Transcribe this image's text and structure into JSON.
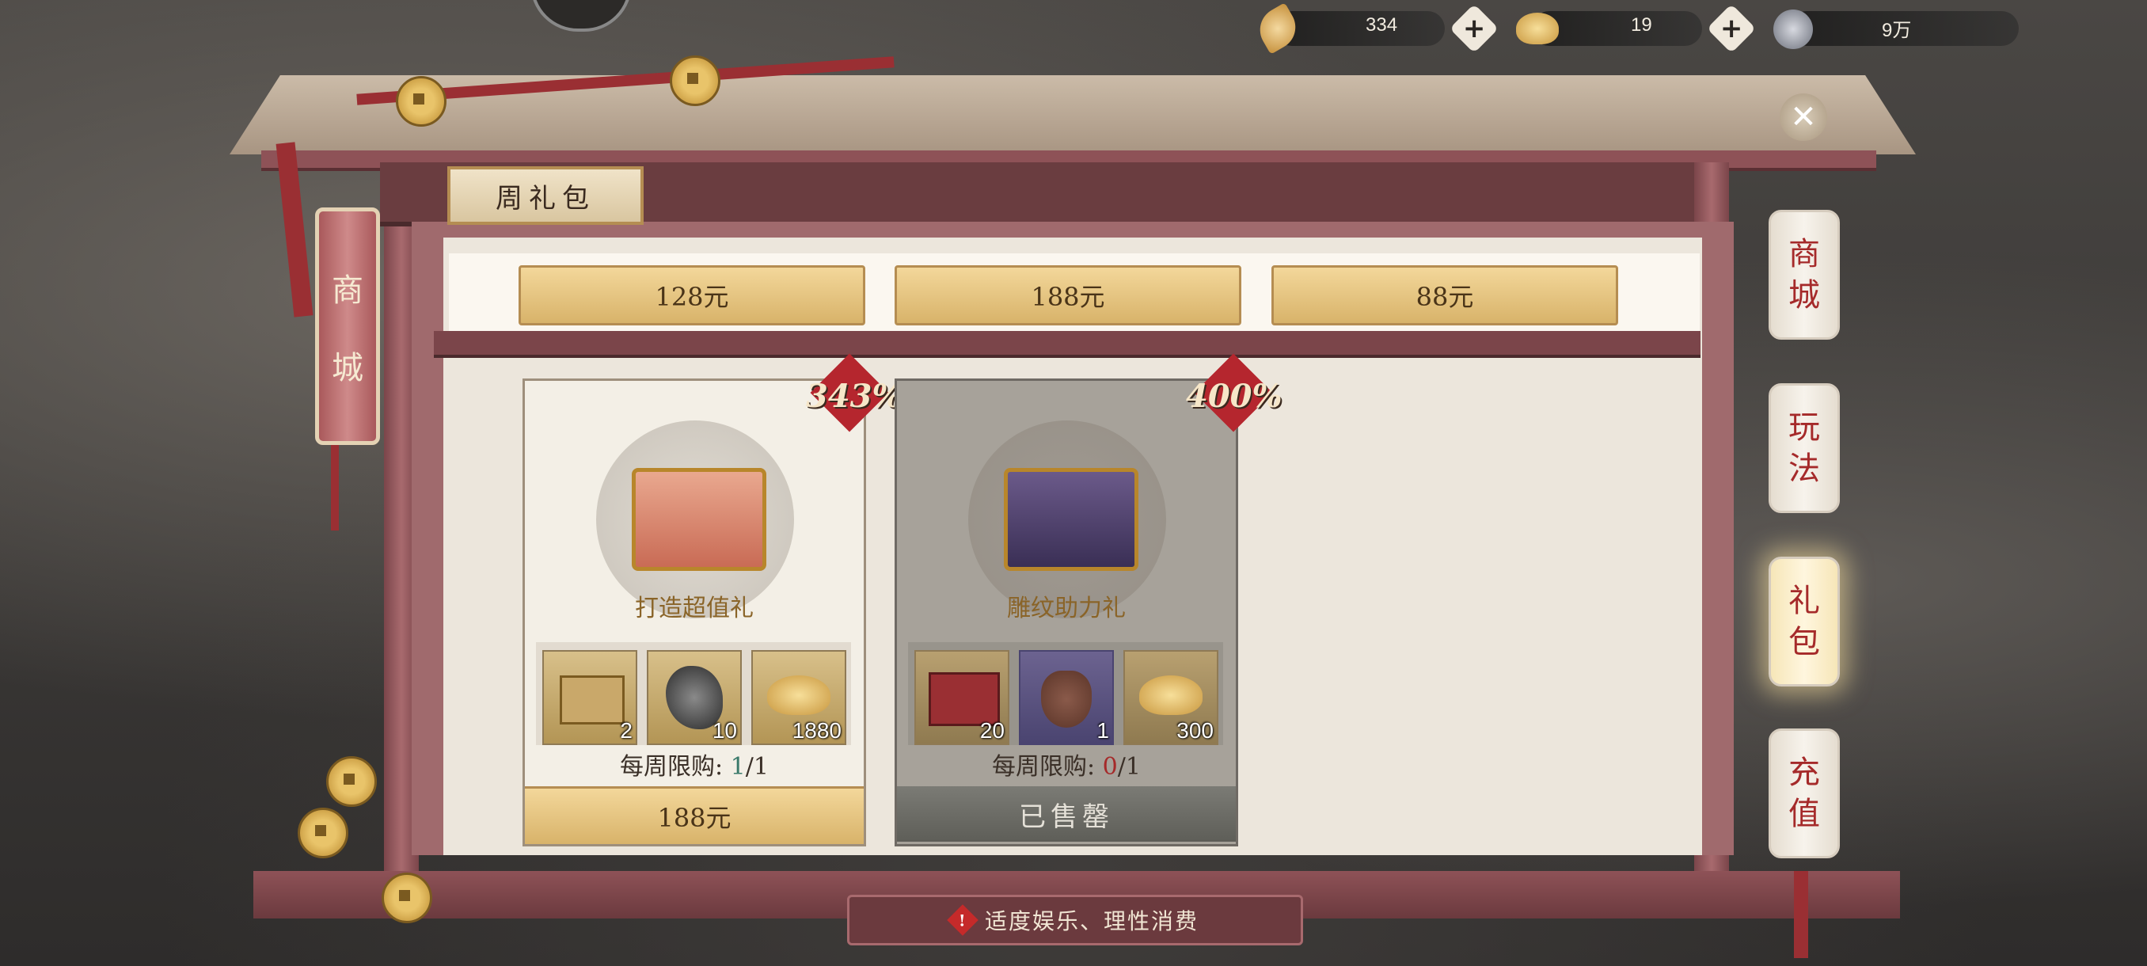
{
  "resources": [
    {
      "icon": "leaf-icon",
      "value": "334"
    },
    {
      "icon": "gold-ingot-icon",
      "value": "19"
    },
    {
      "icon": "copper-coin-icon",
      "value": "9万"
    }
  ],
  "section_title": "周礼包",
  "price_tabs": [
    "128元",
    "188元",
    "88元"
  ],
  "left_scroll": {
    "chars": [
      "商",
      "城"
    ]
  },
  "cards": [
    {
      "name": "打造超值礼",
      "bonus": "343%",
      "items": [
        {
          "icon": "material-chest-icon",
          "count": "2"
        },
        {
          "icon": "iron-ore-icon",
          "count": "10"
        },
        {
          "icon": "gold-ingot-icon",
          "count": "1880"
        }
      ],
      "limit_label": "每周限购:",
      "limit_used": "1",
      "limit_sep": "/",
      "limit_total": "1",
      "button": "188元",
      "sold_out": false
    },
    {
      "name": "雕纹助力礼",
      "bonus": "400%",
      "items": [
        {
          "icon": "red-box-icon",
          "count": "20"
        },
        {
          "icon": "pouch-icon",
          "count": "1"
        },
        {
          "icon": "gold-ingot-icon",
          "count": "300"
        }
      ],
      "limit_label": "每周限购:",
      "limit_used": "0",
      "limit_sep": "/",
      "limit_total": "1",
      "button": "已售罄",
      "sold_out": true
    }
  ],
  "side_tabs": [
    {
      "c1": "商",
      "c2": "城",
      "active": false
    },
    {
      "c1": "玩",
      "c2": "法",
      "active": false
    },
    {
      "c1": "礼",
      "c2": "包",
      "active": true
    },
    {
      "c1": "充",
      "c2": "值",
      "active": false
    }
  ],
  "notice": "适度娱乐、理性消费",
  "colors": {
    "accent_red": "#a52a2a",
    "gold": "#d8b36a",
    "frame": "#7b454a"
  }
}
